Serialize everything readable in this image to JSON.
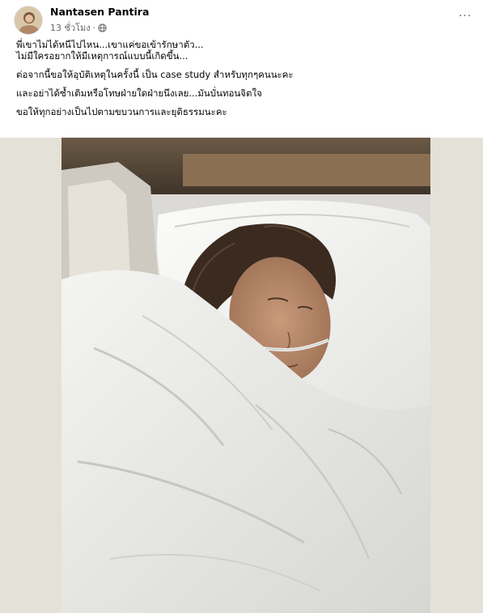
{
  "post": {
    "author": "Nantasen Pantira",
    "timestamp": "13 ชั่วโมง",
    "separator": "·",
    "privacy_icon": "globe-icon",
    "more_icon": "more-options-icon",
    "more_label": "···",
    "text_lines": [
      "พี่เขาไม่ได้หนีไปไหน...เขาแค่ขอเข้ารักษาตัว...",
      "ไม่มีใครอยากให้มีเหตุการณ์แบบนี้เกิดขึ้น...",
      "ต่อจากนี้ขอให้อุบัติเหตุในครั้งนี้ เป็น case study สำหรับทุกๆคนนะคะ",
      "และอย่าได้ซ้ำเติมหรือโทษฝ่ายใดฝ่ายนึงเลย...มันบั่นทอนจิตใจ",
      "ขอให้ทุกอย่างเป็นไปตามขบวนการและยุติธรรมนะคะ"
    ]
  },
  "colors": {
    "text_primary": "#050505",
    "text_secondary": "#65676b",
    "photo_backdrop": "#e4e1d8"
  }
}
